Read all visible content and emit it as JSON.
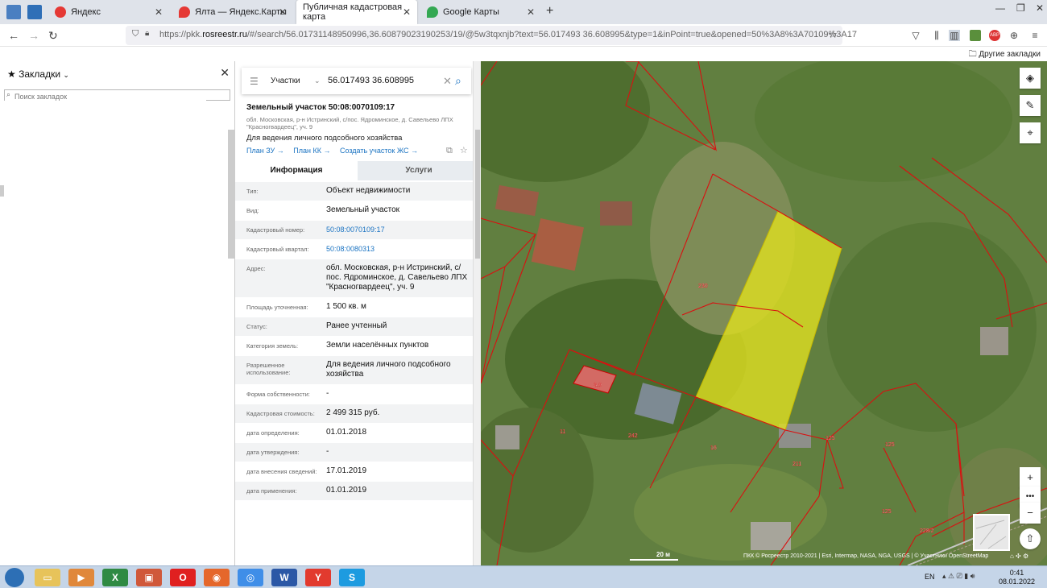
{
  "browser": {
    "tabs": [
      {
        "label": "Яндекс",
        "fav": "#e53935"
      },
      {
        "label": "Ялта — Яндекс.Карты",
        "fav": "#e53935"
      },
      {
        "label": "Публичная кадастровая карта",
        "fav": "#ffffff",
        "active": true
      },
      {
        "label": "Google Карты",
        "fav": "#34a853"
      }
    ],
    "url_host": "https://pkk.",
    "url_domain": "rosreestr.ru",
    "url_rest": "/#/search/56.01731148950996,36.60879023190253/19/@5w3tqxnjb?text=56.017493 36.608995&type=1&inPoint=true&opened=50%3A8%3A70109%3A17",
    "other_bookmarks": "Другие закладки"
  },
  "sidebar": {
    "title": "Закладки",
    "search_placeholder": "Поиск закладок"
  },
  "search": {
    "scope": "Участки",
    "query": "56.017493 36.608995"
  },
  "object": {
    "title": "Земельный участок 50:08:0070109:17",
    "address_short": "обл. Московская, р-н Истринский, с/пос. Ядроминское, д. Савельево ЛПХ \"Красногвардеец\", уч. 9",
    "purpose": "Для ведения личного подсобного хозяйства",
    "links": [
      "План ЗУ →",
      "План КК →",
      "Создать участок ЖС →"
    ],
    "tabs": {
      "info": "Информация",
      "services": "Услуги"
    }
  },
  "rows": [
    {
      "k": "Тип:",
      "v": "Объект недвижимости"
    },
    {
      "k": "Вид:",
      "v": "Земельный участок"
    },
    {
      "k": "Кадастровый номер:",
      "v": "50:08:0070109:17",
      "link": true
    },
    {
      "k": "Кадастровый квартал:",
      "v": "50:08:0080313",
      "link": true
    },
    {
      "k": "Адрес:",
      "v": "обл. Московская, р-н Истринский, с/пос. Ядроминское, д. Савельево ЛПХ \"Красногвардеец\", уч. 9",
      "h": 48
    },
    {
      "k": "Площадь уточненная:",
      "v": "1 500 кв. м"
    },
    {
      "k": "Статус:",
      "v": "Ранее учтенный"
    },
    {
      "k": "Категория земель:",
      "v": "Земли населённых пунктов"
    },
    {
      "k": "Разрешенное использование:",
      "v": "Для ведения личного подсобного хозяйства",
      "h": 36
    },
    {
      "k": "Форма собственности:",
      "v": "-"
    },
    {
      "k": "Кадастровая стоимость:",
      "v": "2 499 315 руб."
    },
    {
      "k": "дата определения:",
      "v": "01.01.2018"
    },
    {
      "k": "дата утверждения:",
      "v": "-"
    },
    {
      "k": "дата внесения сведений:",
      "v": "17.01.2019"
    },
    {
      "k": "дата применения:",
      "v": "01.01.2019"
    }
  ],
  "map": {
    "labels": [
      "230",
      "3.0",
      "11",
      "242",
      "16",
      "211",
      "125",
      "125",
      "125",
      "228/2"
    ],
    "scale": "20 м",
    "attribution": "ПКК © Росреестр 2010-2021 | Esri, Intermap, NASA, NGA, USGS | © Участники OpenStreetMap"
  },
  "taskbar": {
    "lang": "EN",
    "time": "0:41",
    "date": "08.01.2022"
  }
}
